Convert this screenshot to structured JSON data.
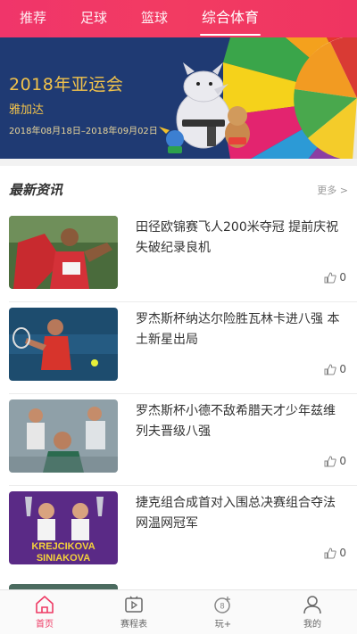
{
  "top_tabs": [
    {
      "label": "推荐",
      "active": false
    },
    {
      "label": "足球",
      "active": false
    },
    {
      "label": "篮球",
      "active": false
    },
    {
      "label": "综合体育",
      "active": true
    }
  ],
  "banner": {
    "title": "2018年亚运会",
    "subtitle": "雅加达",
    "dates": "2018年08月18日–2018年09月02日"
  },
  "news": {
    "header": "最新资讯",
    "more_label": "更多 >",
    "items": [
      {
        "title": "田径欧锦赛飞人200米夺冠 提前庆祝失破纪录良机",
        "likes": "0",
        "thumb": "sprinter-flag"
      },
      {
        "title": "罗杰斯杯纳达尔险胜瓦林卡进八强 本土新星出局",
        "likes": "0",
        "thumb": "tennis-nadal"
      },
      {
        "title": "罗杰斯杯小德不敌希腊天才少年兹维列夫晋级八强",
        "likes": "0",
        "thumb": "tennis-crowd"
      },
      {
        "title": "捷克组合成首对入围总决赛组合夺法网温网冠军",
        "likes": "0",
        "thumb": "krejcikova-siniakova",
        "thumb_text": [
          "KREJCIKOVA",
          "SINIAKOVA"
        ]
      }
    ]
  },
  "bottom_nav": [
    {
      "label": "首页",
      "icon": "home-icon",
      "active": true
    },
    {
      "label": "赛程表",
      "icon": "schedule-icon",
      "active": false
    },
    {
      "label": "玩+",
      "icon": "play-plus-icon",
      "active": false
    },
    {
      "label": "我的",
      "icon": "profile-icon",
      "active": false
    }
  ],
  "colors": {
    "brand": "#ef3461",
    "banner_bg": "#1f3a73",
    "banner_text": "#f1c24b"
  }
}
